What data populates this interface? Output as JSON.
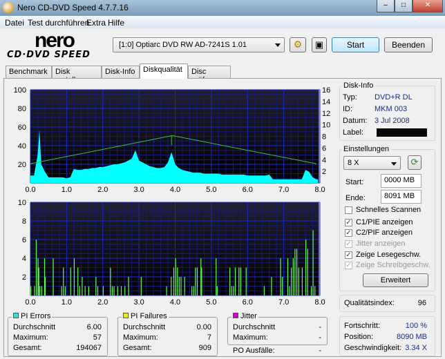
{
  "window": {
    "title": "Nero CD-DVD Speed 4.7.7.16",
    "controls": [
      "minimize",
      "maximize",
      "close"
    ]
  },
  "menu": [
    "Datei",
    "Test durchführen",
    "Extra",
    "Hilfe"
  ],
  "logo": {
    "line1": "nero",
    "line2": "CD·DVD SPEED"
  },
  "toolbar": {
    "drive": "[1:0]  Optiarc DVD RW AD-7241S 1.01",
    "start": "Start",
    "exit": "Beenden"
  },
  "tabs": [
    "Benchmark",
    "Disk erstellen",
    "Disk-Info",
    "Diskqualität",
    "Disc prüfen"
  ],
  "active_tab": "Diskqualität",
  "disk_info": {
    "title": "Disk-Info",
    "type_label": "Typ:",
    "type": "DVD+R DL",
    "id_label": "ID:",
    "id": "MKM 003",
    "date_label": "Datum:",
    "date": "3 Jul 2008",
    "label_label": "Label:"
  },
  "settings": {
    "title": "Einstellungen",
    "speed": "8 X",
    "start_label": "Start:",
    "start": "0000 MB",
    "end_label": "Ende:",
    "end": "8091 MB",
    "checks": [
      {
        "label": "Schnelles Scannen",
        "checked": false,
        "enabled": true
      },
      {
        "label": "C1/PIE anzeigen",
        "checked": true,
        "enabled": true
      },
      {
        "label": "C2/PIF anzeigen",
        "checked": true,
        "enabled": true
      },
      {
        "label": "Jitter anzeigen",
        "checked": true,
        "enabled": false
      },
      {
        "label": "Zeige Lesegeschw.",
        "checked": true,
        "enabled": true
      },
      {
        "label": "Zeige Schreibgeschw.",
        "checked": true,
        "enabled": false
      }
    ],
    "advanced": "Erweitert"
  },
  "quality": {
    "label": "Qualitätsindex:",
    "value": "96"
  },
  "progress": {
    "progress_label": "Fortschritt:",
    "progress": "100 %",
    "position_label": "Position:",
    "position": "8090 MB",
    "speed_label": "Geschwindigkeit:",
    "speed": "3.34 X"
  },
  "stats": {
    "pi_errors": {
      "title": "PI Errors",
      "color": "#33e0e0",
      "avg_label": "Durchschnitt",
      "avg": "6.00",
      "max_label": "Maximum:",
      "max": "57",
      "total_label": "Gesamt:",
      "total": "194067"
    },
    "pi_failures": {
      "title": "PI Failures",
      "color": "#f0f000",
      "avg_label": "Durchschnitt",
      "avg": "0.00",
      "max_label": "Maximum:",
      "max": "7",
      "total_label": "Gesamt:",
      "total": "909"
    },
    "jitter": {
      "title": "Jitter",
      "color": "#d000d0",
      "avg_label": "Durchschnitt",
      "avg": "-",
      "max_label": "Maximum:",
      "max": "-",
      "po_label": "PO Ausfälle:",
      "po": "-"
    }
  },
  "chart_data": [
    {
      "type": "area",
      "series_name": "PI Errors",
      "color": "#00ffff",
      "xlim": [
        0,
        8
      ],
      "ylim": [
        0,
        100
      ],
      "y2lim": [
        0,
        16
      ],
      "xticks": [
        "0.0",
        "1.0",
        "2.0",
        "3.0",
        "4.0",
        "5.0",
        "6.0",
        "7.0",
        "8.0"
      ],
      "yticks": [
        "20",
        "40",
        "60",
        "80",
        "100"
      ],
      "y2ticks": [
        "2",
        "4",
        "6",
        "8",
        "10",
        "12",
        "14",
        "16"
      ],
      "points": [
        [
          0,
          8
        ],
        [
          0.1,
          8
        ],
        [
          0.2,
          30
        ],
        [
          0.25,
          57
        ],
        [
          0.3,
          20
        ],
        [
          0.4,
          12
        ],
        [
          0.5,
          6
        ],
        [
          0.6,
          6
        ],
        [
          0.7,
          6
        ],
        [
          0.8,
          6
        ],
        [
          0.9,
          6
        ],
        [
          1.0,
          5
        ],
        [
          1.1,
          6
        ],
        [
          1.2,
          15
        ],
        [
          1.3,
          14
        ],
        [
          1.4,
          14
        ],
        [
          1.5,
          15
        ],
        [
          1.6,
          15
        ],
        [
          1.7,
          16
        ],
        [
          1.8,
          16
        ],
        [
          1.9,
          17
        ],
        [
          2.0,
          17
        ],
        [
          2.1,
          18
        ],
        [
          2.2,
          19
        ],
        [
          2.3,
          20
        ],
        [
          2.4,
          20
        ],
        [
          2.5,
          21
        ],
        [
          2.6,
          22
        ],
        [
          2.7,
          24
        ],
        [
          2.8,
          26
        ],
        [
          2.9,
          35
        ],
        [
          3.0,
          24
        ],
        [
          3.1,
          22
        ],
        [
          3.2,
          20
        ],
        [
          3.3,
          18
        ],
        [
          3.4,
          17
        ],
        [
          3.5,
          16
        ],
        [
          3.6,
          16
        ],
        [
          3.7,
          17
        ],
        [
          3.8,
          22
        ],
        [
          3.9,
          33
        ],
        [
          4.0,
          20
        ],
        [
          4.1,
          16
        ],
        [
          4.2,
          14
        ],
        [
          4.3,
          13
        ],
        [
          4.4,
          12
        ],
        [
          4.5,
          11
        ],
        [
          4.6,
          11
        ],
        [
          4.7,
          11
        ],
        [
          4.8,
          10
        ],
        [
          4.9,
          10
        ],
        [
          5.0,
          10
        ],
        [
          5.1,
          10
        ],
        [
          5.2,
          10
        ],
        [
          5.3,
          9
        ],
        [
          5.4,
          9
        ],
        [
          5.5,
          9
        ],
        [
          5.6,
          9
        ],
        [
          5.7,
          9
        ],
        [
          5.8,
          9
        ],
        [
          5.9,
          9
        ],
        [
          6.0,
          8
        ],
        [
          6.1,
          8
        ],
        [
          6.2,
          8
        ],
        [
          6.3,
          8
        ],
        [
          6.4,
          8
        ],
        [
          6.5,
          8
        ],
        [
          6.6,
          9
        ],
        [
          6.7,
          4
        ],
        [
          6.8,
          4
        ],
        [
          6.9,
          4
        ],
        [
          7.0,
          4
        ],
        [
          7.1,
          4
        ],
        [
          7.2,
          4
        ],
        [
          7.3,
          4
        ],
        [
          7.4,
          4
        ],
        [
          7.5,
          4
        ],
        [
          7.6,
          14
        ],
        [
          7.7,
          12
        ],
        [
          7.8,
          6
        ],
        [
          7.9,
          4
        ]
      ],
      "speed_series": {
        "color": "#40c040",
        "points": [
          [
            0,
            3.3
          ],
          [
            3.9,
            8.1
          ],
          [
            3.9,
            6.5
          ],
          [
            3.9,
            8.1
          ],
          [
            3.95,
            8.1
          ],
          [
            7.9,
            3.3
          ]
        ]
      }
    },
    {
      "type": "bar",
      "series_name": "PI Failures",
      "color": "#60ff40",
      "xlim": [
        0,
        8
      ],
      "ylim": [
        0,
        10
      ],
      "xticks": [
        "0.0",
        "1.0",
        "2.0",
        "3.0",
        "4.0",
        "5.0",
        "6.0",
        "7.0",
        "8.0"
      ],
      "yticks": [
        "2",
        "4",
        "6",
        "8",
        "10"
      ],
      "points": [
        [
          0.0,
          1
        ],
        [
          0.1,
          1
        ],
        [
          0.15,
          6
        ],
        [
          0.2,
          4
        ],
        [
          0.22,
          3
        ],
        [
          0.25,
          1
        ],
        [
          0.3,
          1
        ],
        [
          0.38,
          4
        ],
        [
          0.4,
          2
        ],
        [
          0.62,
          4
        ],
        [
          0.85,
          1
        ],
        [
          0.9,
          3
        ],
        [
          0.95,
          1
        ],
        [
          1.1,
          3
        ],
        [
          1.2,
          4
        ],
        [
          1.3,
          3
        ],
        [
          1.35,
          1
        ],
        [
          1.42,
          2
        ],
        [
          1.5,
          1
        ],
        [
          1.6,
          1
        ],
        [
          1.8,
          2
        ],
        [
          1.85,
          1
        ],
        [
          2.0,
          1
        ],
        [
          2.2,
          3
        ],
        [
          2.25,
          1
        ],
        [
          2.3,
          1
        ],
        [
          2.4,
          1
        ],
        [
          2.5,
          1
        ],
        [
          2.6,
          1
        ],
        [
          2.7,
          2
        ],
        [
          3.05,
          2
        ],
        [
          3.75,
          1
        ],
        [
          3.88,
          2
        ],
        [
          3.95,
          3
        ],
        [
          4.0,
          4
        ],
        [
          4.05,
          3
        ],
        [
          4.1,
          2
        ],
        [
          4.15,
          2
        ],
        [
          4.25,
          2
        ],
        [
          4.45,
          1
        ],
        [
          4.5,
          1
        ],
        [
          4.55,
          3
        ],
        [
          4.6,
          3
        ],
        [
          4.7,
          4
        ],
        [
          4.72,
          3
        ],
        [
          5.12,
          4
        ],
        [
          5.15,
          1
        ],
        [
          5.5,
          3
        ],
        [
          5.55,
          1
        ],
        [
          5.6,
          1
        ],
        [
          5.65,
          3
        ],
        [
          5.75,
          3
        ],
        [
          5.8,
          3
        ],
        [
          5.95,
          3
        ],
        [
          6.45,
          1
        ],
        [
          6.65,
          2
        ],
        [
          6.9,
          4
        ],
        [
          6.95,
          2
        ],
        [
          7.1,
          4
        ],
        [
          7.15,
          1
        ],
        [
          7.2,
          3
        ],
        [
          7.25,
          4
        ],
        [
          7.3,
          5
        ],
        [
          7.35,
          5
        ],
        [
          7.4,
          3
        ],
        [
          7.5,
          3
        ],
        [
          7.6,
          6
        ],
        [
          7.65,
          5
        ],
        [
          7.75,
          1
        ],
        [
          7.8,
          7
        ],
        [
          7.85,
          1
        ]
      ]
    }
  ]
}
